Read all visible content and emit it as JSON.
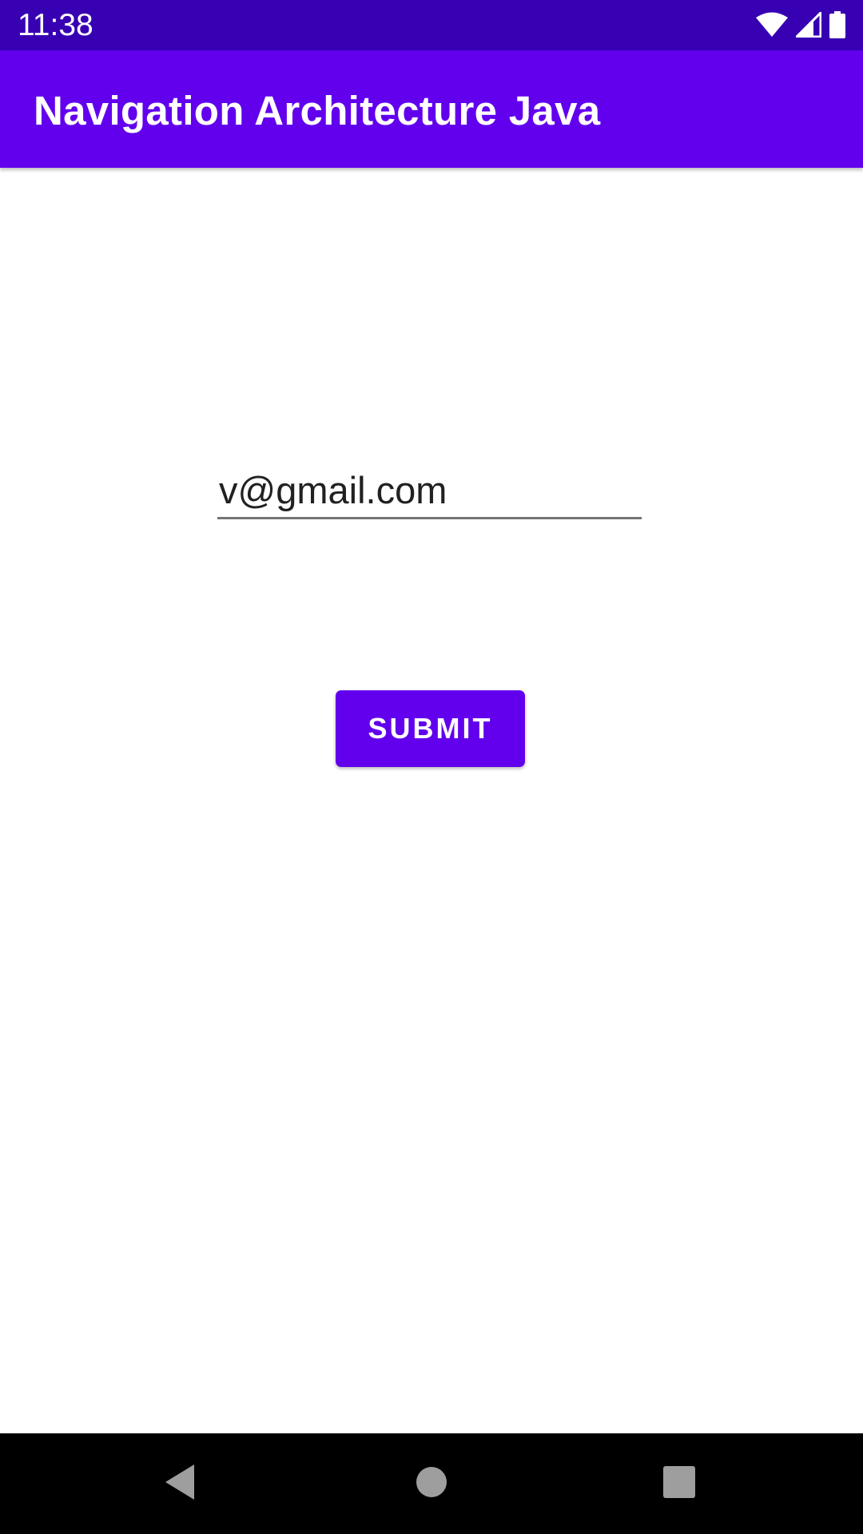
{
  "status_bar": {
    "time": "11:38",
    "icons": [
      "wifi-icon",
      "cellular-signal-icon",
      "battery-icon"
    ]
  },
  "app_bar": {
    "title": "Navigation Architecture Java"
  },
  "form": {
    "email_value": "v@gmail.com",
    "submit_label": "SUBMIT"
  },
  "nav_bar": {
    "icons": [
      "back-icon",
      "home-icon",
      "recents-icon"
    ]
  },
  "colors": {
    "status_bar": "#3700B3",
    "primary": "#6200EE",
    "text": "#212121"
  }
}
